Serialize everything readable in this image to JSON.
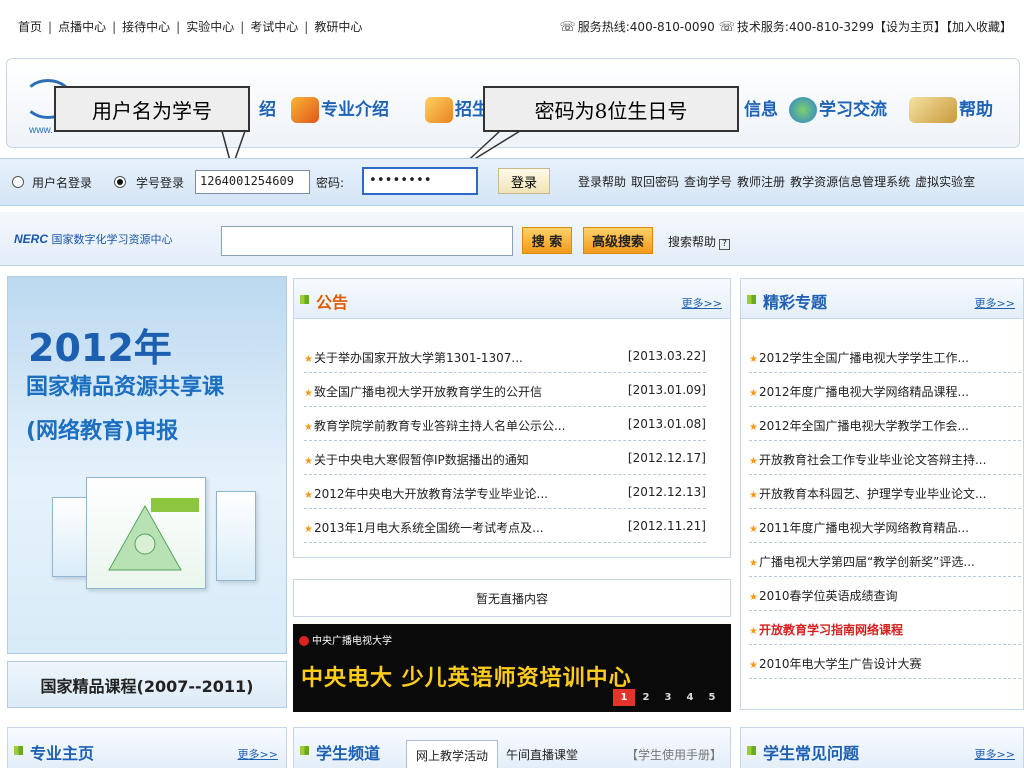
{
  "topnav": {
    "items": [
      "首页",
      "点播中心",
      "接待中心",
      "实验中心",
      "考试中心",
      "教研中心"
    ],
    "hotline": "服务热线:400-810-0090",
    "tech_service": "技术服务:400-810-3299",
    "set_home": "【设为主页】",
    "add_favorite": "【加入收藏】"
  },
  "banner": {
    "logo_url": "www.",
    "menu": [
      "绍",
      "专业介绍",
      "招生",
      "信息",
      "学习交流",
      "帮助"
    ]
  },
  "callouts": {
    "username": "用户名为学号",
    "password": "密码为8位生日号"
  },
  "login": {
    "username_login": "用户名登录",
    "student_login": "学号登录",
    "student_id_value": "1264001254609",
    "password_label": "密码:",
    "password_value": "••••••••",
    "login_button": "登录",
    "links": [
      "登录帮助",
      "取回密码",
      "查询学号",
      "教师注册",
      "教学资源信息管理系统",
      "虚拟实验室"
    ]
  },
  "search": {
    "nerc_logo": "NERC",
    "nerc_text": "国家数字化学习资源中心",
    "search_button": "搜 索",
    "advanced_button": "高级搜索",
    "help": "搜索帮助",
    "help_icon": "?"
  },
  "promo": {
    "year": "2012年",
    "line1": "国家精品资源共享课",
    "line2": "(网络教育)申报",
    "caption": "国家精品课程(2007--2011)"
  },
  "notice": {
    "title": "公告",
    "more": "更多>>",
    "items": [
      {
        "title": "关于举办国家开放大学第1301-1307...",
        "date": "[2013.03.22]"
      },
      {
        "title": "致全国广播电视大学开放教育学生的公开信",
        "date": "[2013.01.09]"
      },
      {
        "title": "教育学院学前教育专业答辩主持人名单公示公...",
        "date": "[2013.01.08]"
      },
      {
        "title": "关于中央电大寒假暂停IP数据播出的通知",
        "date": "[2012.12.17]"
      },
      {
        "title": "2012年中央电大开放教育法学专业毕业论...",
        "date": "[2012.12.13]"
      },
      {
        "title": "2013年1月电大系统全国统一考试考点及...",
        "date": "[2012.11.21]"
      }
    ]
  },
  "live": {
    "text": "暂无直播内容"
  },
  "ad": {
    "logo_text": "中央广播电视大学",
    "main_text": "中央电大  少儿英语师资培训中心",
    "pages": [
      "1",
      "2",
      "3",
      "4",
      "5"
    ],
    "active_page": 0
  },
  "special": {
    "title": "精彩专题",
    "more": "更多>>",
    "items": [
      {
        "title": "2012学生全国广播电视大学学生工作...",
        "highlight": false
      },
      {
        "title": "2012年度广播电视大学网络精品课程...",
        "highlight": false
      },
      {
        "title": "2012年全国广播电视大学教学工作会...",
        "highlight": false
      },
      {
        "title": "开放教育社会工作专业毕业论文答辩主持...",
        "highlight": false
      },
      {
        "title": "开放教育本科园艺、护理学专业毕业论文...",
        "highlight": false
      },
      {
        "title": "2011年度广播电视大学网络教育精品...",
        "highlight": false
      },
      {
        "title": "广播电视大学第四届“教学创新奖”评选...",
        "highlight": false
      },
      {
        "title": "2010春学位英语成绩查询",
        "highlight": false
      },
      {
        "title": "开放教育学习指南网络课程",
        "highlight": true
      },
      {
        "title": "2010年电大学生广告设计大赛",
        "highlight": false
      }
    ]
  },
  "bottom": {
    "major_title": "专业主页",
    "major_more": "更多>>",
    "channel_title": "学生频道",
    "channel_tab1": "网上教学活动",
    "channel_tab2": "午间直播课堂",
    "student_manual": "【学生使用手册】",
    "faq_title": "学生常见问题",
    "faq_more": "更多>>"
  },
  "colors": {
    "brand_blue": "#1d5fb0",
    "accent_orange": "#f39a1a",
    "highlight_red": "#d81e1e"
  }
}
